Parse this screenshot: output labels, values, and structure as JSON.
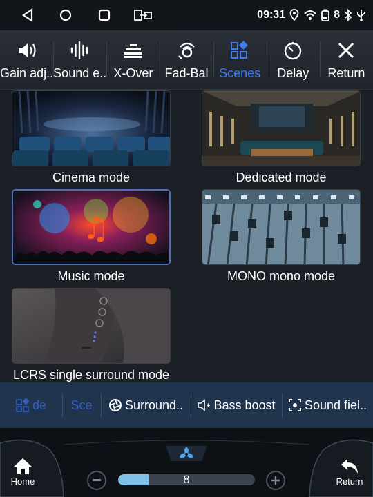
{
  "status": {
    "time": "09:31",
    "battery": "8"
  },
  "toolbar": {
    "items": [
      {
        "label": "Gain adj..",
        "icon": "speaker-volume-icon"
      },
      {
        "label": "Sound e..",
        "icon": "waveform-icon"
      },
      {
        "label": "X-Over",
        "icon": "equalizer-bars-icon"
      },
      {
        "label": "Fad-Bal",
        "icon": "fader-balance-icon"
      },
      {
        "label": "Scenes",
        "icon": "scenes-grid-icon",
        "active": true
      },
      {
        "label": "Delay",
        "icon": "timer-icon"
      },
      {
        "label": "Return",
        "icon": "close-icon"
      }
    ]
  },
  "scenes": [
    {
      "caption": "Cinema mode"
    },
    {
      "caption": "Dedicated mode"
    },
    {
      "caption": "Music mode",
      "selected": true
    },
    {
      "caption": "MONO mono mode"
    },
    {
      "caption": "LCRS single surround mode"
    }
  ],
  "bottom_tabs": {
    "scenes_short": "de",
    "scenes_short2": "Sce",
    "surround": "Surround..",
    "bass": "Bass boost",
    "soundfield": "Sound fiel.."
  },
  "dock": {
    "home_label": "Home",
    "return_label": "Return",
    "fan_level": "8",
    "fan_fraction": 0.22
  },
  "colors": {
    "accent": "#3e7cf0",
    "bottom_bar": "#21344e"
  }
}
